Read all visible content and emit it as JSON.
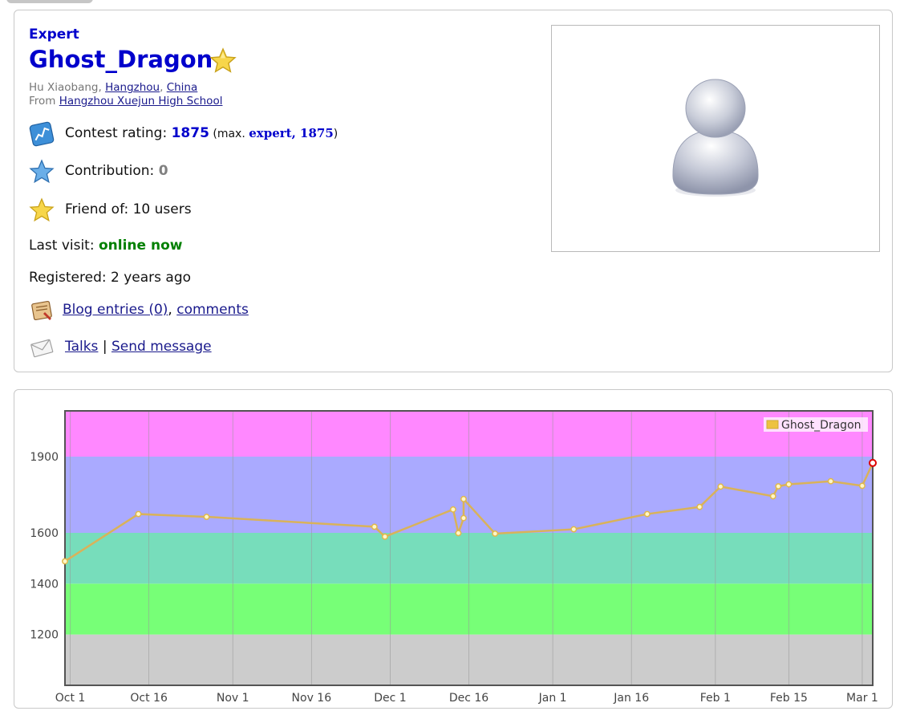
{
  "profile": {
    "rank": "Expert",
    "handle": "Ghost_Dragon",
    "name": "Hu Xiaobang",
    "separator1": ", ",
    "city": "Hangzhou",
    "separator2": ", ",
    "country": "China",
    "from_label": "From ",
    "organization": "Hangzhou Xuejun High School",
    "contest_rating_label": "Contest rating: ",
    "contest_rating": "1875",
    "max_open": " (max. ",
    "max_rank": "expert, ",
    "max_rating": "1875",
    "max_close": ")",
    "contribution_label": "Contribution: ",
    "contribution": "0",
    "friend_of": "Friend of: 10 users",
    "last_visit_label": "Last visit: ",
    "last_visit": "online now",
    "registered": "Registered: 2 years ago",
    "blog_entries": "Blog entries (0)",
    "comma": ", ",
    "comments": "comments",
    "talks": "Talks",
    "pipe": " | ",
    "send_message": "Send message"
  },
  "colors": {
    "rank_blue": "#0000cc",
    "online_green": "#008000",
    "line": "#edc240",
    "band_gray": "#cccccc",
    "band_green": "#77ff77",
    "band_cyan": "#77ddbb",
    "band_blue": "#aaaaff",
    "band_purple": "#ff88ff"
  },
  "chart_data": {
    "type": "line",
    "legend": "Ghost_Dragon",
    "legend_position": "top-right",
    "grid": true,
    "x_ticks": [
      "Oct 1",
      "Oct 16",
      "Nov 1",
      "Nov 16",
      "Dec 1",
      "Dec 16",
      "Jan 1",
      "Jan 16",
      "Feb 1",
      "Feb 15",
      "Mar 1"
    ],
    "y_ticks": [
      1200,
      1400,
      1600,
      1900
    ],
    "ylim": [
      1000,
      2080
    ],
    "bands": [
      {
        "from": 1000,
        "to": 1200,
        "color": "#cccccc"
      },
      {
        "from": 1200,
        "to": 1400,
        "color": "#77ff77"
      },
      {
        "from": 1400,
        "to": 1600,
        "color": "#77ddbb"
      },
      {
        "from": 1600,
        "to": 1900,
        "color": "#aaaaff"
      },
      {
        "from": 1900,
        "to": 2080,
        "color": "#ff88ff"
      }
    ],
    "series": [
      {
        "name": "Ghost_Dragon",
        "points": [
          {
            "x": "Sep 30",
            "y": 1488
          },
          {
            "x": "Oct 14",
            "y": 1674
          },
          {
            "x": "Oct 27",
            "y": 1663
          },
          {
            "x": "Nov 28",
            "y": 1624
          },
          {
            "x": "Nov 30",
            "y": 1585
          },
          {
            "x": "Dec 13",
            "y": 1692
          },
          {
            "x": "Dec 14",
            "y": 1599
          },
          {
            "x": "Dec 15",
            "y": 1658
          },
          {
            "x": "Dec 15",
            "y": 1733
          },
          {
            "x": "Dec 21",
            "y": 1597
          },
          {
            "x": "Jan 5",
            "y": 1614
          },
          {
            "x": "Jan 19",
            "y": 1674
          },
          {
            "x": "Jan 29",
            "y": 1702
          },
          {
            "x": "Feb 2",
            "y": 1782
          },
          {
            "x": "Feb 12",
            "y": 1744
          },
          {
            "x": "Feb 13",
            "y": 1783
          },
          {
            "x": "Feb 15",
            "y": 1791
          },
          {
            "x": "Feb 23",
            "y": 1803
          },
          {
            "x": "Mar 1",
            "y": 1785
          },
          {
            "x": "Mar 3",
            "y": 1875
          }
        ]
      }
    ]
  }
}
